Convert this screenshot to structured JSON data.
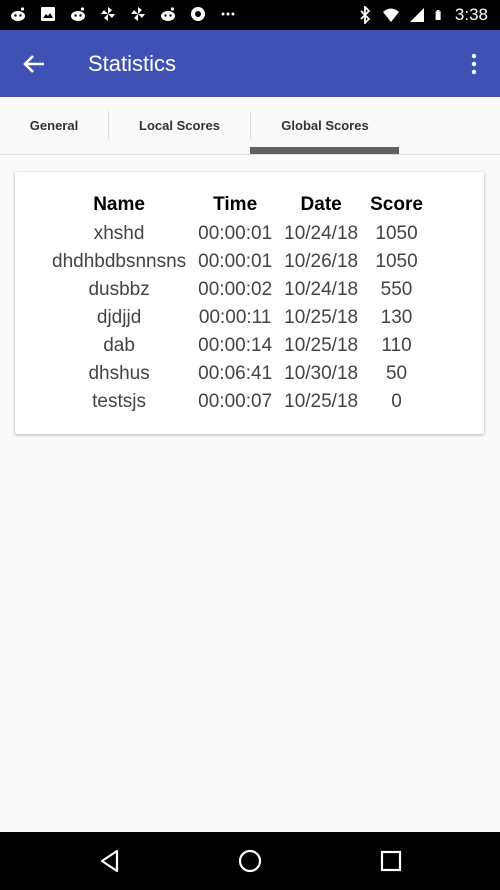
{
  "status_bar": {
    "time": "3:38",
    "icons": [
      "reddit-icon",
      "image-icon",
      "reddit-icon",
      "pinwheel-icon",
      "pinwheel-icon",
      "reddit-icon",
      "circle-icon",
      "dots-icon",
      "bluetooth-icon",
      "wifi-icon",
      "signal-icon",
      "battery-icon"
    ]
  },
  "app_bar": {
    "title": "Statistics",
    "color": "#3f51b5"
  },
  "tabs": [
    {
      "label": "General",
      "selected": false
    },
    {
      "label": "Local Scores",
      "selected": false
    },
    {
      "label": "Global Scores",
      "selected": true
    }
  ],
  "scores_table": {
    "headers": [
      "Name",
      "Time",
      "Date",
      "Score"
    ],
    "rows": [
      [
        "xhshd",
        "00:00:01",
        "10/24/18",
        "1050"
      ],
      [
        "dhdhbdbsnnsns",
        "00:00:01",
        "10/26/18",
        "1050"
      ],
      [
        "dusbbz",
        "00:00:02",
        "10/24/18",
        "550"
      ],
      [
        "djdjjd",
        "00:00:11",
        "10/25/18",
        "130"
      ],
      [
        "dab",
        "00:00:14",
        "10/25/18",
        "110"
      ],
      [
        "dhshus",
        "00:06:41",
        "10/30/18",
        "50"
      ],
      [
        "testsjs",
        "00:00:07",
        "10/25/18",
        "0"
      ]
    ]
  }
}
